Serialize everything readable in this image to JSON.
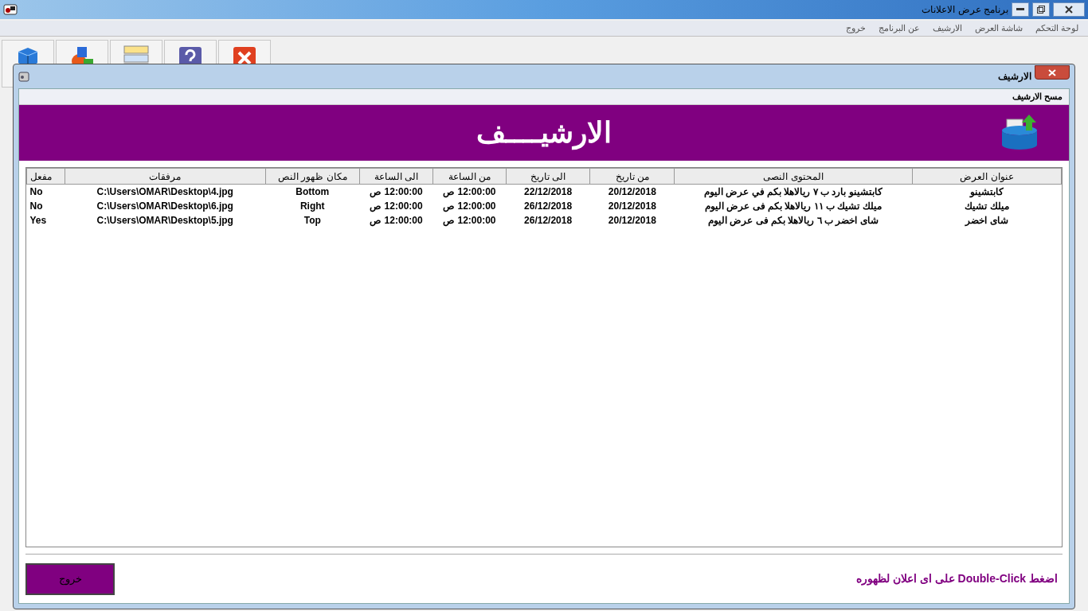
{
  "window": {
    "title": "برنامج عرض الاعلانات"
  },
  "menu": [
    "لوحة التحكم",
    "شاشة العرض",
    "الارشيف",
    "عن البرنامج",
    "خروج"
  ],
  "toolbar": [
    {
      "kind": "cube"
    },
    {
      "kind": "shapes"
    },
    {
      "kind": "list"
    },
    {
      "kind": "help"
    },
    {
      "kind": "close"
    }
  ],
  "dialog": {
    "title": "الارشيف",
    "menu": [
      "مسح الارشيف"
    ],
    "banner": "الارشيــــف",
    "table": {
      "columns": [
        "عنوان العرض",
        "المحتوى النصى",
        "من تاريخ",
        "الى تاريخ",
        "من الساعة",
        "الى الساعة",
        "مكان ظهور النص",
        "مرفقات",
        "مفعل"
      ],
      "rows": [
        [
          "كابتشينو",
          "كابتشينو بارد ب ٧ ريالاهلا بكم في عرض اليوم",
          "20/12/2018",
          "22/12/2018",
          "12:00:00 ص",
          "12:00:00 ص",
          "Bottom",
          "C:\\Users\\OMAR\\Desktop\\4.jpg",
          "No"
        ],
        [
          "ميلك تشيك",
          "ميلك تشيك ب ١١ ريالاهلا بكم فى عرض اليوم",
          "20/12/2018",
          "26/12/2018",
          "12:00:00 ص",
          "12:00:00 ص",
          "Right",
          "C:\\Users\\OMAR\\Desktop\\6.jpg",
          "No"
        ],
        [
          "شاى اخضر",
          "شاى اخضر ب ٦ ريالاهلا بكم فى عرض اليوم",
          "20/12/2018",
          "26/12/2018",
          "12:00:00 ص",
          "12:00:00 ص",
          "Top",
          "C:\\Users\\OMAR\\Desktop\\5.jpg",
          "Yes"
        ]
      ]
    },
    "hint": "اضغط Double-Click على اى اعلان لظهوره",
    "exit_button": "خروج"
  }
}
